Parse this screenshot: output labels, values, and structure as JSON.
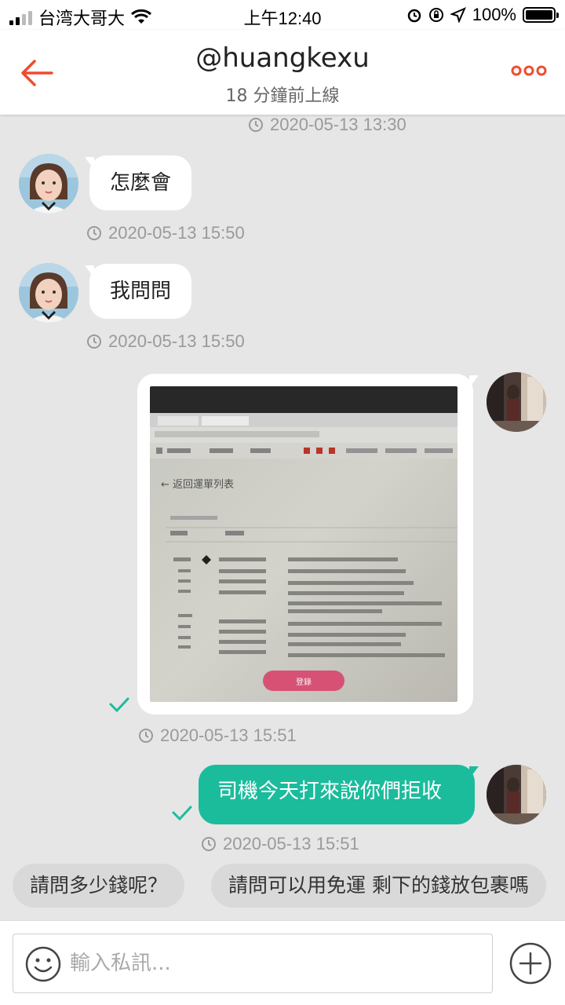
{
  "status_bar": {
    "carrier": "台湾大哥大",
    "time": "上午12:40",
    "battery": "100%"
  },
  "header": {
    "title": "@huangkexu",
    "subtitle": "18 分鐘前上線"
  },
  "messages": [
    {
      "timestamp": "2020-05-13 13:30"
    },
    {
      "sender": "other",
      "text": "怎麼會",
      "timestamp": "2020-05-13 15:50"
    },
    {
      "sender": "other",
      "text": "我問問",
      "timestamp": "2020-05-13 15:50"
    },
    {
      "sender": "me",
      "type": "image",
      "timestamp": "2020-05-13 15:51"
    },
    {
      "sender": "me",
      "text": "司機今天打來說你們拒收",
      "timestamp": "2020-05-13 15:51"
    }
  ],
  "photo_text": {
    "back_link": "← 返回運單列表",
    "button": "登錄"
  },
  "quick_replies": [
    {
      "label": "請問多少錢呢？"
    },
    {
      "label": "請問可以用免運 剩下的錢放包裹嗎"
    }
  ],
  "input": {
    "placeholder": "輸入私訊..."
  },
  "colors": {
    "accent": "#ee4d2d",
    "outgoing_bubble": "#1abc9c",
    "background": "#e6e6e6"
  },
  "icons": [
    "back-arrow-icon",
    "more-dots-icon",
    "clock-icon",
    "check-icon",
    "emoji-icon",
    "plus-icon"
  ]
}
